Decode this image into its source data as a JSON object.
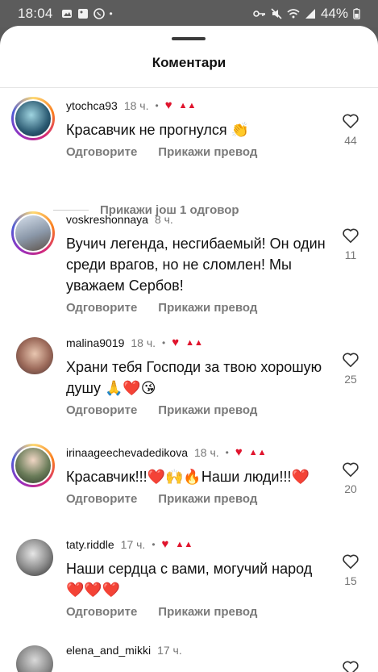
{
  "status": {
    "time": "18:04",
    "battery": "44%"
  },
  "sheet": {
    "title": "Коментари"
  },
  "actions": {
    "reply": "Одговорите",
    "translate": "Прикажи превод"
  },
  "more_replies": "Прикажи још 1 одговор",
  "comments": [
    {
      "user": "ytochca93",
      "time": "18 ч.",
      "text": "Красавчик не прогнулся 👏",
      "likes": "44"
    },
    {
      "user": "voskreshonnaya",
      "time": "8 ч.",
      "text": "Вучич легенда, несгибаемый! Он один среди врагов, но не сломлен! Мы уважаем Сербов!",
      "likes": "11"
    },
    {
      "user": "malina9019",
      "time": "18 ч.",
      "text": "Храни тебя Господи за твою хорошую душу 🙏❤️😘",
      "likes": "25"
    },
    {
      "user": "irinaageechevadedikova",
      "time": "18 ч.",
      "text": "Красавчик!!!❤️🙌🔥Наши люди!!!❤️",
      "likes": "20"
    },
    {
      "user": "taty.riddle",
      "time": "17 ч.",
      "text": "Наши сердца с вами, могучий народ ❤️❤️❤️",
      "likes": "15"
    },
    {
      "user": "elena_and_mikki",
      "time": "17 ч."
    }
  ]
}
